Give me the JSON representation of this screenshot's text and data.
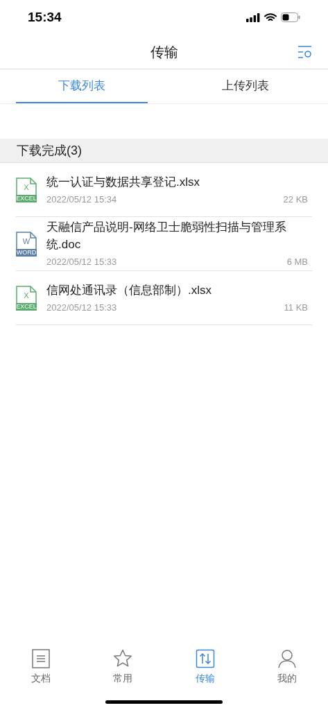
{
  "status_bar": {
    "time": "15:34"
  },
  "header": {
    "title": "传输"
  },
  "tabs": [
    {
      "label": "下载列表",
      "selected": true
    },
    {
      "label": "上传列表",
      "selected": false
    }
  ],
  "section": {
    "title": "下载完成(3)"
  },
  "files": [
    {
      "kind": "excel",
      "icon_letter": "X",
      "icon_label": "EXCEL",
      "name": "统一认证与数据共享登记.xlsx",
      "date": "2022/05/12 15:34",
      "size": "22 KB"
    },
    {
      "kind": "word",
      "icon_letter": "W",
      "icon_label": "WORD",
      "name": "天融信产品说明-网络卫士脆弱性扫描与管理系统.doc",
      "date": "2022/05/12 15:33",
      "size": "6 MB"
    },
    {
      "kind": "excel",
      "icon_letter": "X",
      "icon_label": "EXCEL",
      "name": "信网处通讯录（信息部制）.xlsx",
      "date": "2022/05/12 15:33",
      "size": "11 KB"
    }
  ],
  "bottom_nav": [
    {
      "kind": "document",
      "label": "文档",
      "selected": false
    },
    {
      "kind": "star",
      "label": "常用",
      "selected": false
    },
    {
      "kind": "transfer",
      "label": "传输",
      "selected": true
    },
    {
      "kind": "person",
      "label": "我的",
      "selected": false
    }
  ]
}
